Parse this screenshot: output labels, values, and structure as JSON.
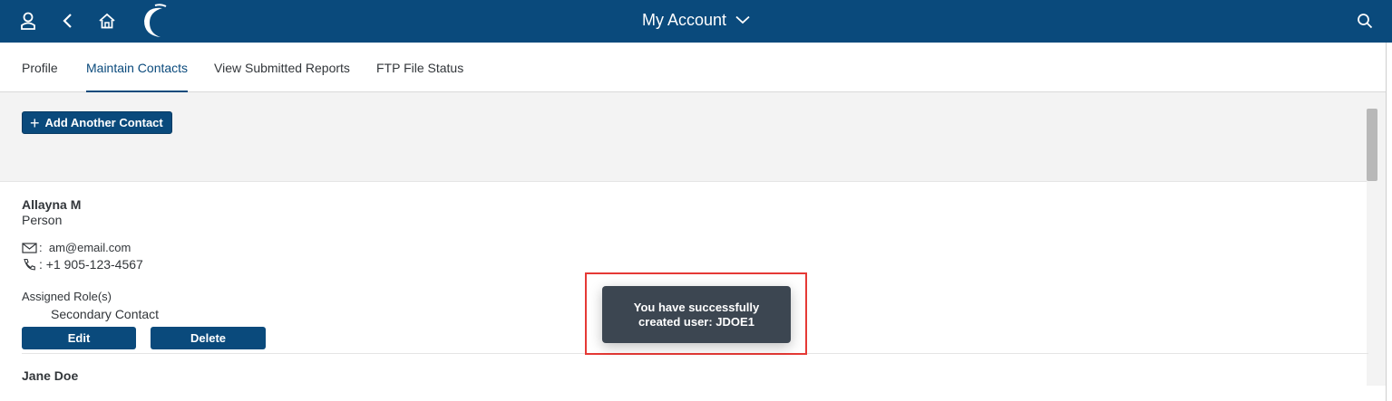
{
  "header": {
    "title": "My Account",
    "icons": {
      "user": "user-icon",
      "back": "back-icon",
      "home": "home-icon",
      "logo": "logo-icon",
      "dropdown": "chevron-down-icon",
      "search": "search-icon"
    },
    "color": "#0a4a7c"
  },
  "tabs": [
    {
      "label": "Profile",
      "active": false
    },
    {
      "label": "Maintain Contacts",
      "active": true
    },
    {
      "label": "View Submitted Reports",
      "active": false
    },
    {
      "label": "FTP File Status",
      "active": false
    }
  ],
  "toolbar": {
    "add_label": "Add Another Contact"
  },
  "contacts": [
    {
      "name": "Allayna M",
      "type": "Person",
      "email": "am@email.com",
      "phone": "+1 905-123-4567",
      "roles_label": "Assigned Role(s)",
      "roles": [
        "Secondary Contact"
      ],
      "edit_label": "Edit",
      "delete_label": "Delete"
    },
    {
      "name": "Jane Doe"
    }
  ],
  "toast": {
    "message": "You have successfully created user: JDOE1"
  }
}
